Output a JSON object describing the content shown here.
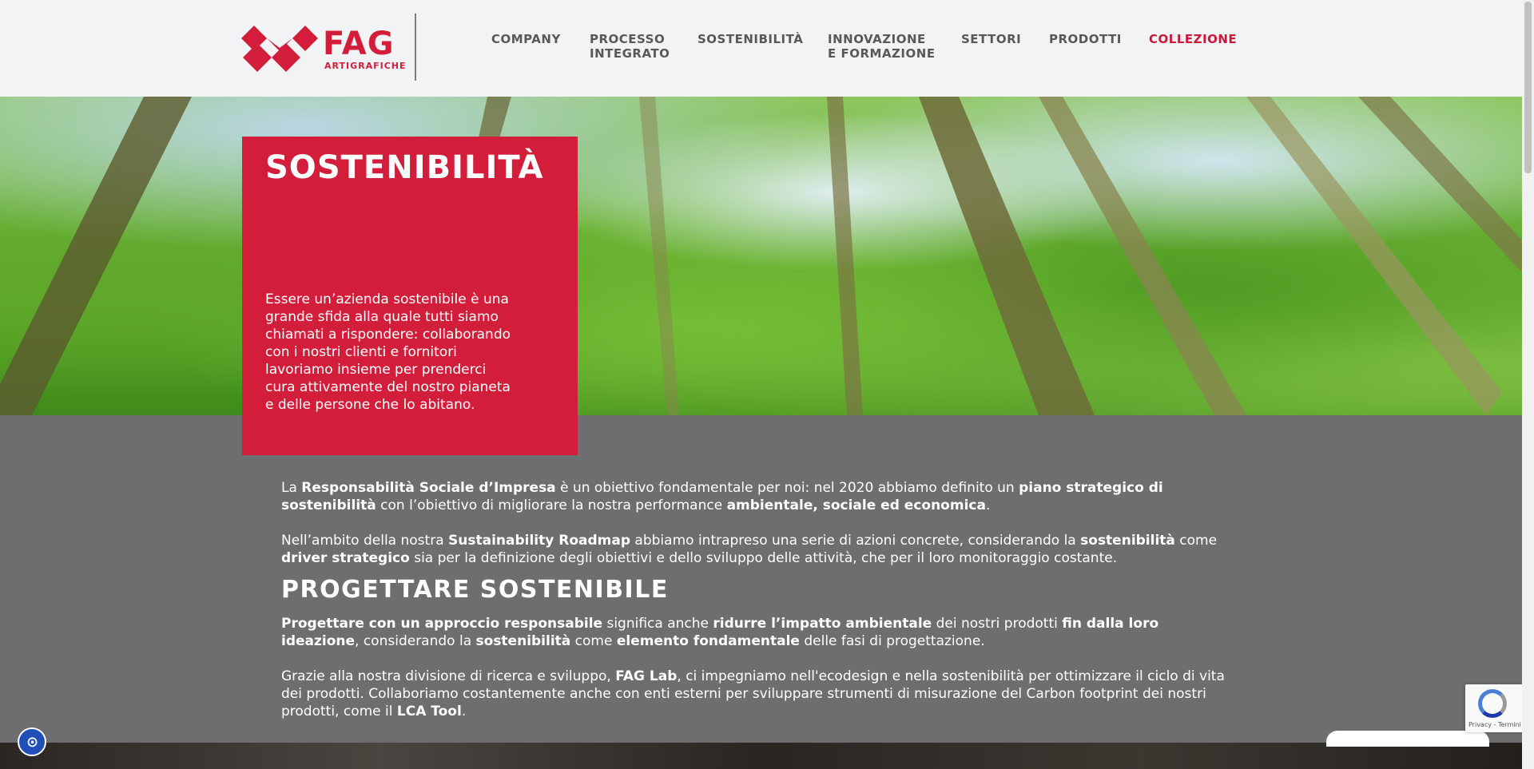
{
  "header": {
    "logo_word": "FAG",
    "logo_sub": "ARTIGRAFICHE",
    "nav": [
      {
        "line1": "COMPANY",
        "line2": ""
      },
      {
        "line1": "PROCESSO",
        "line2": "INTEGRATO"
      },
      {
        "line1": "SOSTENIBILITÀ",
        "line2": ""
      },
      {
        "line1": "INNOVAZIONE",
        "line2": "E FORMAZIONE"
      },
      {
        "line1": "SETTORI",
        "line2": ""
      },
      {
        "line1": "PRODOTTI",
        "line2": ""
      },
      {
        "line1": "COLLEZIONE",
        "line2": ""
      }
    ]
  },
  "hero": {
    "title": "SOSTENIBILITÀ",
    "text": "Essere un’azienda sostenibile è una grande sfida alla quale tutti siamo chiamati a rispondere: collaborando con i nostri clienti e fornitori lavoriamo insieme per prenderci cura attivamente del nostro pianeta e delle persone che lo abitano."
  },
  "content": {
    "p1": {
      "t1": "La ",
      "b1": "Responsabilità Sociale d’Impresa",
      "t2": " è un obiettivo fondamentale per noi: nel 2020 abbiamo definito un ",
      "b2": "piano strategico di sostenibilità",
      "t3": " con l’obiettivo di migliorare la nostra performance ",
      "b3": "ambientale, sociale ed economica",
      "t4": "."
    },
    "p2": {
      "t1": "Nell’ambito della nostra ",
      "b1": "Sustainability Roadmap",
      "t2": " abbiamo intrapreso una serie di azioni concrete, considerando la ",
      "b2": "sostenibilità",
      "t3": " come ",
      "b3": "driver strategico",
      "t4": " sia per la definizione degli obiettivi e dello sviluppo delle attività, che per il loro monitoraggio costante."
    },
    "heading": "PROGETTARE SOSTENIBILE",
    "p3": {
      "b1": "Progettare con un approccio responsabile",
      "t1": " significa anche ",
      "b2": "ridurre l’impatto ambientale",
      "t2": " dei nostri prodotti ",
      "b3": "fin dalla loro ideazione",
      "t3": ", considerando la ",
      "b4": "sostenibilità",
      "t4": " come ",
      "b5": "elemento fondamentale",
      "t5": " delle fasi di progettazione."
    },
    "p4": {
      "t1": "Grazie alla nostra divisione di ricerca e sviluppo, ",
      "b1": "FAG Lab",
      "t2": ", ci impegniamo nell'ecodesign e nella sostenibilità per ottimizzare il ciclo di vita dei prodotti. Collaboriamo costantemente anche con enti esterni per sviluppare strumenti di misurazione del Carbon footprint dei nostri prodotti, come il ",
      "b2": "LCA Tool",
      "t3": "."
    }
  },
  "recaptcha": {
    "text": "Privacy - Termini"
  },
  "colors": {
    "brand_red": "#d21e3a",
    "content_bg": "#6e6e70",
    "header_bg": "#f2f3f4"
  }
}
